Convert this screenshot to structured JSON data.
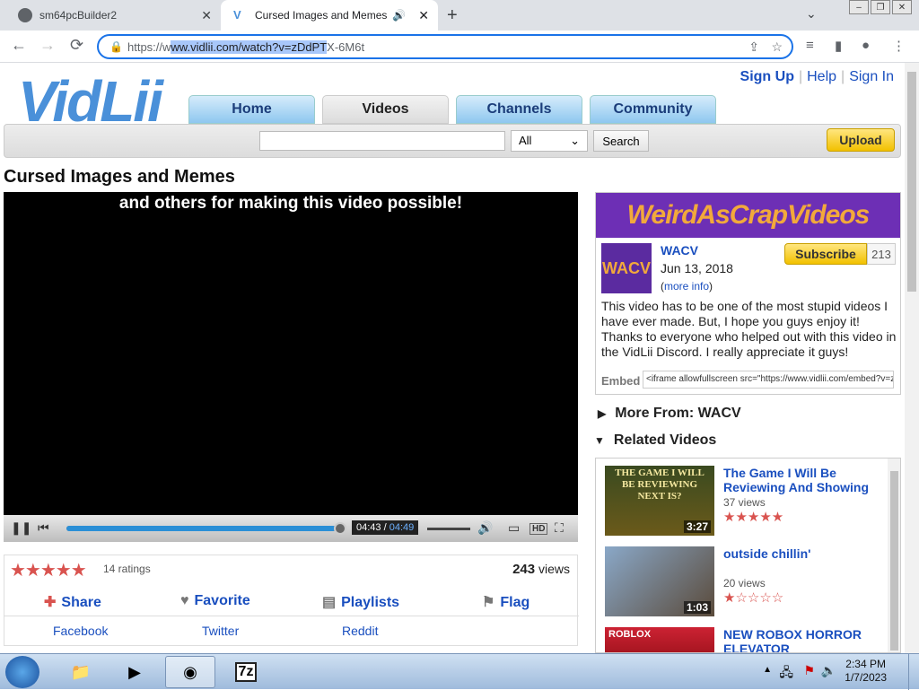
{
  "browser": {
    "tabs": [
      {
        "title": "sm64pcBuilder2"
      },
      {
        "title": "Cursed Images and Memes"
      }
    ],
    "url_prefix": "https://w",
    "url_selected": "ww.vidlii.com/watch?v=zDdPT",
    "url_suffix": "X-6M6t"
  },
  "site": {
    "logo": "VidLii",
    "links": {
      "signup": "Sign Up",
      "help": "Help",
      "signin": "Sign In"
    },
    "nav": [
      "Home",
      "Videos",
      "Channels",
      "Community"
    ],
    "search": {
      "scope": "All",
      "button": "Search",
      "upload": "Upload"
    }
  },
  "video": {
    "title": "Cursed Images and Memes",
    "caption": "and others for making this video possible!",
    "time_current": "04:43",
    "time_sep": " / ",
    "time_total": "04:49",
    "progress": 0.98,
    "rating_count": "14 ratings",
    "views_number": "243",
    "views_label": " views",
    "actions": {
      "share": "Share",
      "favorite": "Favorite",
      "playlists": "Playlists",
      "flag": "Flag"
    },
    "share_targets": [
      "Facebook",
      "Twitter",
      "Reddit"
    ]
  },
  "channel": {
    "banner": "WeirdAsCrapVideos",
    "avatar": "WACV",
    "name": "WACV",
    "date": "Jun 13, 2018",
    "more_open": "(",
    "more_info": "more info",
    "more_close": ")",
    "subscribe": "Subscribe",
    "subscribers": "213",
    "description": "This video has to be one of the most stupid videos I have ever made. But, I hope you guys enjoy it! Thanks to everyone who helped out with this video in the VidLii Discord. I really appreciate it guys!",
    "embed_label": "Embed",
    "embed_code": "<iframe allowfullscreen src=\"https://www.vidlii.com/embed?v=z"
  },
  "sidebar": {
    "more_from": "More From: WACV",
    "related_label": "Related Videos",
    "related": [
      {
        "title": "The Game I Will Be Reviewing And Showing",
        "views": "37 views",
        "duration": "3:27",
        "thumb_text": "THE GAME I WILL BE REVIEWING NEXT IS?"
      },
      {
        "title": "outside chillin'",
        "views": "20 views",
        "duration": "1:03"
      },
      {
        "title": "NEW ROBOX HORROR ELEVATOR",
        "thumb_text": "ROBLOX"
      }
    ]
  },
  "taskbar": {
    "time": "2:34 PM",
    "date": "1/7/2023",
    "apps": [
      "windows-explorer",
      "media-player",
      "chrome",
      "7-zip"
    ],
    "sevenzip_label": "7z"
  }
}
